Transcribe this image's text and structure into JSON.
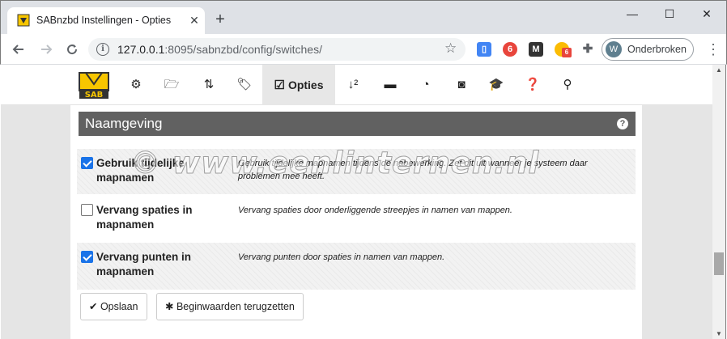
{
  "browser": {
    "tab_title": "SABnzbd Instellingen - Opties",
    "tab_close": "✕",
    "new_tab": "+",
    "window_controls": {
      "minimize": "—",
      "maximize": "☐",
      "close": "✕"
    },
    "url_host": "127.0.0.1",
    "url_path": ":8095/sabnzbd/config/switches/",
    "profile_initial": "W",
    "profile_label": "Onderbroken",
    "extension_badge": "6"
  },
  "navbar": {
    "active_label": "Opties",
    "items": [
      {
        "icon": "gear-icon",
        "glyph": "⚙"
      },
      {
        "icon": "folder-icon",
        "glyph": "📂"
      },
      {
        "icon": "sort-icon",
        "glyph": "⇅"
      },
      {
        "icon": "tag-icon",
        "glyph": "🏷"
      },
      {
        "icon": "check-square-icon",
        "glyph": "☑"
      },
      {
        "icon": "sort-numeric-icon",
        "glyph": "↓"
      },
      {
        "icon": "comment-icon",
        "glyph": "💬"
      },
      {
        "icon": "clock-icon",
        "glyph": "🕒"
      },
      {
        "icon": "rss-icon",
        "glyph": "☰"
      },
      {
        "icon": "graduation-cap-icon",
        "glyph": "🎓"
      },
      {
        "icon": "question-icon",
        "glyph": "?"
      },
      {
        "icon": "search-icon",
        "glyph": "⌕"
      }
    ]
  },
  "section": {
    "title": "Naamgeving",
    "help": "?"
  },
  "options": [
    {
      "label": "Gebruik tijdelijke mapnamen",
      "checked": true,
      "description": "Gebruik tijdelijke mapnamen tijdens de nabewerking. Zet dit uit wanneer je systeem daar problemen mee heeft."
    },
    {
      "label": "Vervang spaties in mapnamen",
      "checked": false,
      "description": "Vervang spaties door onderliggende streepjes in namen van mappen."
    },
    {
      "label": "Vervang punten in mapnamen",
      "checked": true,
      "description": "Vervang punten door spaties in namen van mappen."
    }
  ],
  "buttons": {
    "save": "✔ Opslaan",
    "reset": "✱ Beginwaarden terugzetten"
  },
  "watermark": "© www.eenlinternen.nl",
  "colors": {
    "section_header": "#616161",
    "checkbox_checked": "#1a73e8",
    "logo_yellow": "#f7c600"
  }
}
